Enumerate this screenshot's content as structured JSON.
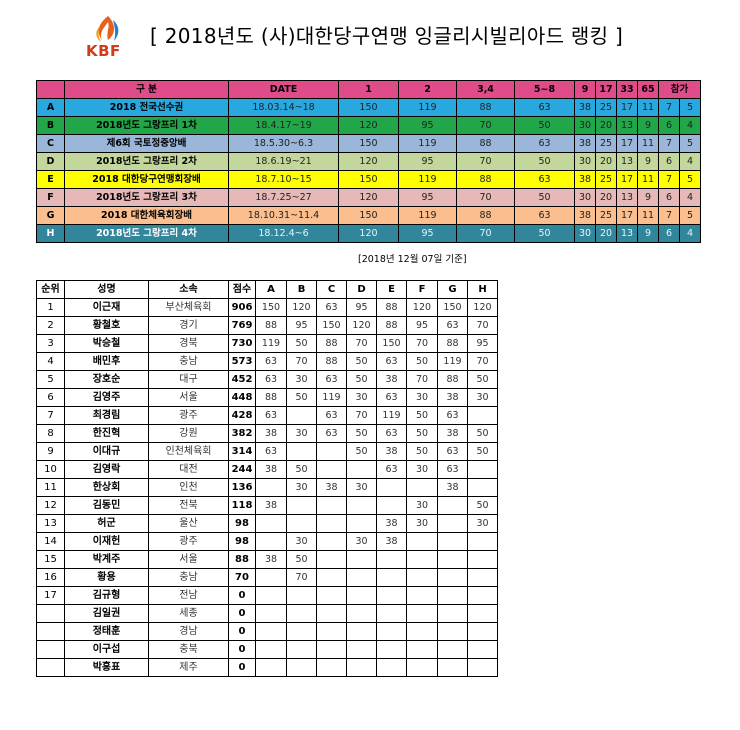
{
  "header": {
    "logo_text": "KBF",
    "title": "[ 2018년도 (사)대한당구연맹 잉글리시빌리아드 랭킹 ]"
  },
  "events_table": {
    "headers": [
      "구 분",
      "DATE",
      "1",
      "2",
      "3,4",
      "5~8",
      "9",
      "17",
      "33",
      "65",
      "참가"
    ],
    "rows": [
      {
        "code": "A",
        "name": "2018 전국선수권",
        "date": "18.03.14~18",
        "p1": "150",
        "p2": "119",
        "p34": "88",
        "p58": "63",
        "p9": "38",
        "p17": "25",
        "p33": "17",
        "p65": "11",
        "part": "7",
        "part_extra": "5",
        "color": "#29a8e0"
      },
      {
        "code": "B",
        "name": "2018년도 그랑프리 1차",
        "date": "18.4.17~19",
        "p1": "120",
        "p2": "95",
        "p34": "70",
        "p58": "50",
        "p9": "30",
        "p17": "20",
        "p33": "13",
        "p65": "9",
        "part": "6",
        "part_extra": "4",
        "color": "#22a64a"
      },
      {
        "code": "C",
        "name": "제6회 국토정중앙배",
        "date": "18.5.30~6.3",
        "p1": "150",
        "p2": "119",
        "p34": "88",
        "p58": "63",
        "p9": "38",
        "p17": "25",
        "p33": "17",
        "p65": "11",
        "part": "7",
        "part_extra": "5",
        "color": "#9ab6d8"
      },
      {
        "code": "D",
        "name": "2018년도 그랑프리 2차",
        "date": "18.6.19~21",
        "p1": "120",
        "p2": "95",
        "p34": "70",
        "p58": "50",
        "p9": "30",
        "p17": "20",
        "p33": "13",
        "p65": "9",
        "part": "6",
        "part_extra": "4",
        "color": "#c3d69b"
      },
      {
        "code": "E",
        "name": "2018 대한당구연맹회장배",
        "date": "18.7.10~15",
        "p1": "150",
        "p2": "119",
        "p34": "88",
        "p58": "63",
        "p9": "38",
        "p17": "25",
        "p33": "17",
        "p65": "11",
        "part": "7",
        "part_extra": "5",
        "color": "#ffff00"
      },
      {
        "code": "F",
        "name": "2018년도 그랑프리 3차",
        "date": "18.7.25~27",
        "p1": "120",
        "p2": "95",
        "p34": "70",
        "p58": "50",
        "p9": "30",
        "p17": "20",
        "p33": "13",
        "p65": "9",
        "part": "6",
        "part_extra": "4",
        "color": "#e6b8b7"
      },
      {
        "code": "G",
        "name": "2018 대한체육회장배",
        "date": "18.10.31~11.4",
        "p1": "150",
        "p2": "119",
        "p34": "88",
        "p58": "63",
        "p9": "38",
        "p17": "25",
        "p33": "17",
        "p65": "11",
        "part": "7",
        "part_extra": "5",
        "color": "#fbbf8f"
      },
      {
        "code": "H",
        "name": "2018년도 그랑프리 4차",
        "date": "18.12.4~6",
        "p1": "120",
        "p2": "95",
        "p34": "70",
        "p58": "50",
        "p9": "30",
        "p17": "20",
        "p33": "13",
        "p65": "9",
        "part": "6",
        "part_extra": "4",
        "color": "#31869b"
      }
    ],
    "header_color": "#e04b8a"
  },
  "as_of": "[2018년 12월 07일 기준]",
  "ranking_table": {
    "headers": [
      "순위",
      "성명",
      "소속",
      "점수",
      "A",
      "B",
      "C",
      "D",
      "E",
      "F",
      "G",
      "H"
    ],
    "rows": [
      {
        "rank": "1",
        "name": "이근재",
        "aff": "부산체육회",
        "pts": "906",
        "s": [
          "150",
          "120",
          "63",
          "95",
          "88",
          "120",
          "150",
          "120"
        ]
      },
      {
        "rank": "2",
        "name": "황철호",
        "aff": "경기",
        "pts": "769",
        "s": [
          "88",
          "95",
          "150",
          "120",
          "88",
          "95",
          "63",
          "70"
        ]
      },
      {
        "rank": "3",
        "name": "박승철",
        "aff": "경북",
        "pts": "730",
        "s": [
          "119",
          "50",
          "88",
          "70",
          "150",
          "70",
          "88",
          "95"
        ]
      },
      {
        "rank": "4",
        "name": "배민후",
        "aff": "충남",
        "pts": "573",
        "s": [
          "63",
          "70",
          "88",
          "50",
          "63",
          "50",
          "119",
          "70"
        ]
      },
      {
        "rank": "5",
        "name": "장호순",
        "aff": "대구",
        "pts": "452",
        "s": [
          "63",
          "30",
          "63",
          "50",
          "38",
          "70",
          "88",
          "50"
        ]
      },
      {
        "rank": "6",
        "name": "김영주",
        "aff": "서울",
        "pts": "448",
        "s": [
          "88",
          "50",
          "119",
          "30",
          "63",
          "30",
          "38",
          "30"
        ]
      },
      {
        "rank": "7",
        "name": "최경림",
        "aff": "광주",
        "pts": "428",
        "s": [
          "63",
          "",
          "63",
          "70",
          "119",
          "50",
          "63",
          ""
        ]
      },
      {
        "rank": "8",
        "name": "한진혁",
        "aff": "강원",
        "pts": "382",
        "s": [
          "38",
          "30",
          "63",
          "50",
          "63",
          "50",
          "38",
          "50"
        ]
      },
      {
        "rank": "9",
        "name": "이대규",
        "aff": "인천체육회",
        "pts": "314",
        "s": [
          "63",
          "",
          "",
          "50",
          "38",
          "50",
          "63",
          "50"
        ]
      },
      {
        "rank": "10",
        "name": "김영락",
        "aff": "대전",
        "pts": "244",
        "s": [
          "38",
          "50",
          "",
          "",
          "63",
          "30",
          "63",
          ""
        ]
      },
      {
        "rank": "11",
        "name": "한상회",
        "aff": "인천",
        "pts": "136",
        "s": [
          "",
          "30",
          "38",
          "30",
          "",
          "",
          "38",
          ""
        ]
      },
      {
        "rank": "12",
        "name": "김동민",
        "aff": "전북",
        "pts": "118",
        "s": [
          "38",
          "",
          "",
          "",
          "",
          "30",
          "",
          "50"
        ]
      },
      {
        "rank": "13",
        "name": "허군",
        "aff": "울산",
        "pts": "98",
        "s": [
          "",
          "",
          "",
          "",
          "38",
          "30",
          "",
          "30"
        ]
      },
      {
        "rank": "14",
        "name": "이재헌",
        "aff": "광주",
        "pts": "98",
        "s": [
          "",
          "30",
          "",
          "30",
          "38",
          "",
          "",
          ""
        ]
      },
      {
        "rank": "15",
        "name": "박계주",
        "aff": "서울",
        "pts": "88",
        "s": [
          "38",
          "50",
          "",
          "",
          "",
          "",
          "",
          ""
        ]
      },
      {
        "rank": "16",
        "name": "황용",
        "aff": "충남",
        "pts": "70",
        "s": [
          "",
          "70",
          "",
          "",
          "",
          "",
          "",
          ""
        ]
      },
      {
        "rank": "17",
        "name": "김규형",
        "aff": "전남",
        "pts": "0",
        "s": [
          "",
          "",
          "",
          "",
          "",
          "",
          "",
          ""
        ]
      },
      {
        "rank": "",
        "name": "김일권",
        "aff": "세종",
        "pts": "0",
        "s": [
          "",
          "",
          "",
          "",
          "",
          "",
          "",
          ""
        ]
      },
      {
        "rank": "",
        "name": "정태훈",
        "aff": "경남",
        "pts": "0",
        "s": [
          "",
          "",
          "",
          "",
          "",
          "",
          "",
          ""
        ]
      },
      {
        "rank": "",
        "name": "이구섭",
        "aff": "충북",
        "pts": "0",
        "s": [
          "",
          "",
          "",
          "",
          "",
          "",
          "",
          ""
        ]
      },
      {
        "rank": "",
        "name": "박홍표",
        "aff": "제주",
        "pts": "0",
        "s": [
          "",
          "",
          "",
          "",
          "",
          "",
          "",
          ""
        ]
      }
    ]
  }
}
